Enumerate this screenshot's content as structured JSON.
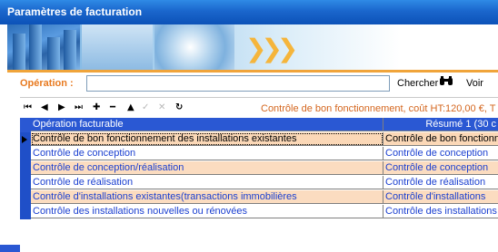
{
  "window": {
    "title": "Paramètres de facturation"
  },
  "banner": {
    "chevrons": "❯❯❯"
  },
  "operation": {
    "label": "Opération :",
    "value": "",
    "search_label": "Chercher",
    "binoculars_icon": "binoculars-icon",
    "voir_label": "Voir"
  },
  "nav": {
    "first": "⏮",
    "prev": "◀",
    "next": "▶",
    "last": "⏭",
    "add": "✚",
    "remove": "━",
    "up": "▲",
    "edit": "✓",
    "cancel": "✕",
    "refresh": "↻"
  },
  "info": {
    "text": "Contrôle de bon fonctionnement,  coût HT:120,00 €,   T"
  },
  "grid": {
    "headers": [
      "Opération facturable",
      "Résumé 1 (30 c"
    ],
    "rows": [
      [
        "Contrôle de bon fonctionnement des installations existantes",
        "Contrôle de bon fonctionn"
      ],
      [
        "Contrôle de conception",
        "Contrôle de conception"
      ],
      [
        "Contrôle de conception/réalisation",
        "Contrôle de conception"
      ],
      [
        "Contrôle de réalisation",
        "Contrôle de réalisation"
      ],
      [
        "Contrôle d'installations existantes(transactions immobilières",
        "Contrôle d'installations"
      ],
      [
        "Contrôle des installations nouvelles ou rénovées",
        "Contrôle des installations"
      ]
    ]
  },
  "colors": {
    "title": "#1a66cc",
    "accent_orange": "#e87a20",
    "grid_header": "#2a58d3",
    "row_alt": "#fbdcc0",
    "link_text": "#1a3fd0"
  }
}
